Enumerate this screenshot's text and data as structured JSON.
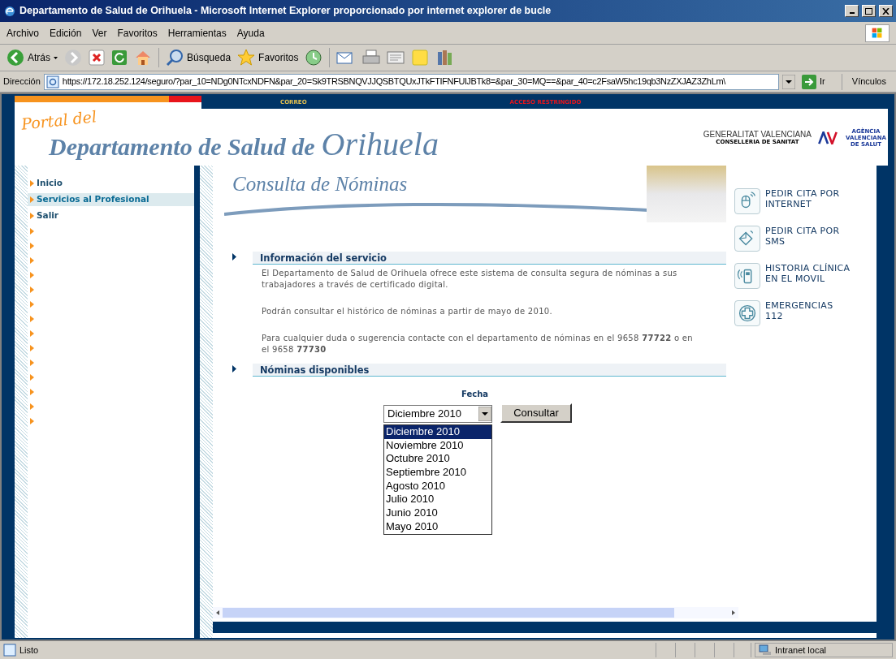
{
  "window": {
    "title": "Departamento de Salud de Orihuela - Microsoft Internet Explorer proporcionado por internet explorer de bucle"
  },
  "menu": [
    "Archivo",
    "Edición",
    "Ver",
    "Favoritos",
    "Herramientas",
    "Ayuda"
  ],
  "toolbar": {
    "back": "Atrás",
    "search": "Búsqueda",
    "favorites": "Favoritos"
  },
  "address": {
    "label": "Dirección",
    "url": "https://172.18.252.124/seguro/?par_10=NDg0NTcxNDFN&par_20=Sk9TRSBNQVJJQSBTQUxJTkFTIFNFUlJBTk8=&par_30=MQ==&par_40=c2FsaW5hc19qb3NzZXJAZ3ZhLm\\",
    "go": "Ir",
    "links": "Vínculos"
  },
  "header": {
    "top_links": [
      "CORREO",
      "ACCESO RESTRINGIDO"
    ],
    "portal": "Portal del",
    "title": "Departamento de Salud de",
    "city": "Orihuela",
    "logo_gva": "GENERALITAT VALENCIANA",
    "logo_gva_sub": "CONSELLERIA DE SANITAT",
    "logo_avs": "AGÈNCIA VALENCIANA DE SALUT"
  },
  "nav": [
    {
      "label": "Inicio",
      "selected": false
    },
    {
      "label": "Servicios al Profesional",
      "selected": true
    },
    {
      "label": "Salir",
      "selected": false
    }
  ],
  "content": {
    "title": "Consulta de Nóminas",
    "sections": [
      {
        "heading": "Información del servicio",
        "paragraphs": [
          "El Departamento de Salud de Orihuela ofrece este sistema de consulta segura de nóminas a sus trabajadores a través de certificado digital.",
          "Podrán consultar el histórico de nóminas a partir de mayo de 2010.",
          "Para cualquier duda o sugerencia contacte con el departamento de nóminas en el 9658 **77722** o en el 9658 **77730**"
        ]
      },
      {
        "heading": "Nóminas disponibles"
      }
    ],
    "form": {
      "label": "Fecha",
      "value": "Diciembre 2010",
      "button": "Consultar",
      "options": [
        {
          "label": "Diciembre 2010",
          "selected": true
        },
        {
          "label": "Noviembre 2010",
          "selected": false
        },
        {
          "label": "Octubre 2010",
          "selected": false
        },
        {
          "label": "Septiembre 2010",
          "selected": false
        },
        {
          "label": "Agosto 2010",
          "selected": false
        },
        {
          "label": "Julio 2010",
          "selected": false
        },
        {
          "label": "Junio 2010",
          "selected": false
        },
        {
          "label": "Mayo 2010",
          "selected": false
        }
      ]
    }
  },
  "side_links": [
    {
      "kind": "mouse",
      "label": "PEDIR CITA POR INTERNET"
    },
    {
      "kind": "sms",
      "label": "PEDIR CITA POR SMS"
    },
    {
      "kind": "phone",
      "label": "HISTORIA CLÍNICA EN EL MOVIL"
    },
    {
      "kind": "cross",
      "label": "EMERGENCIAS 112"
    }
  ],
  "status_bar": {
    "text": "Listo",
    "zone": "Intranet local"
  }
}
